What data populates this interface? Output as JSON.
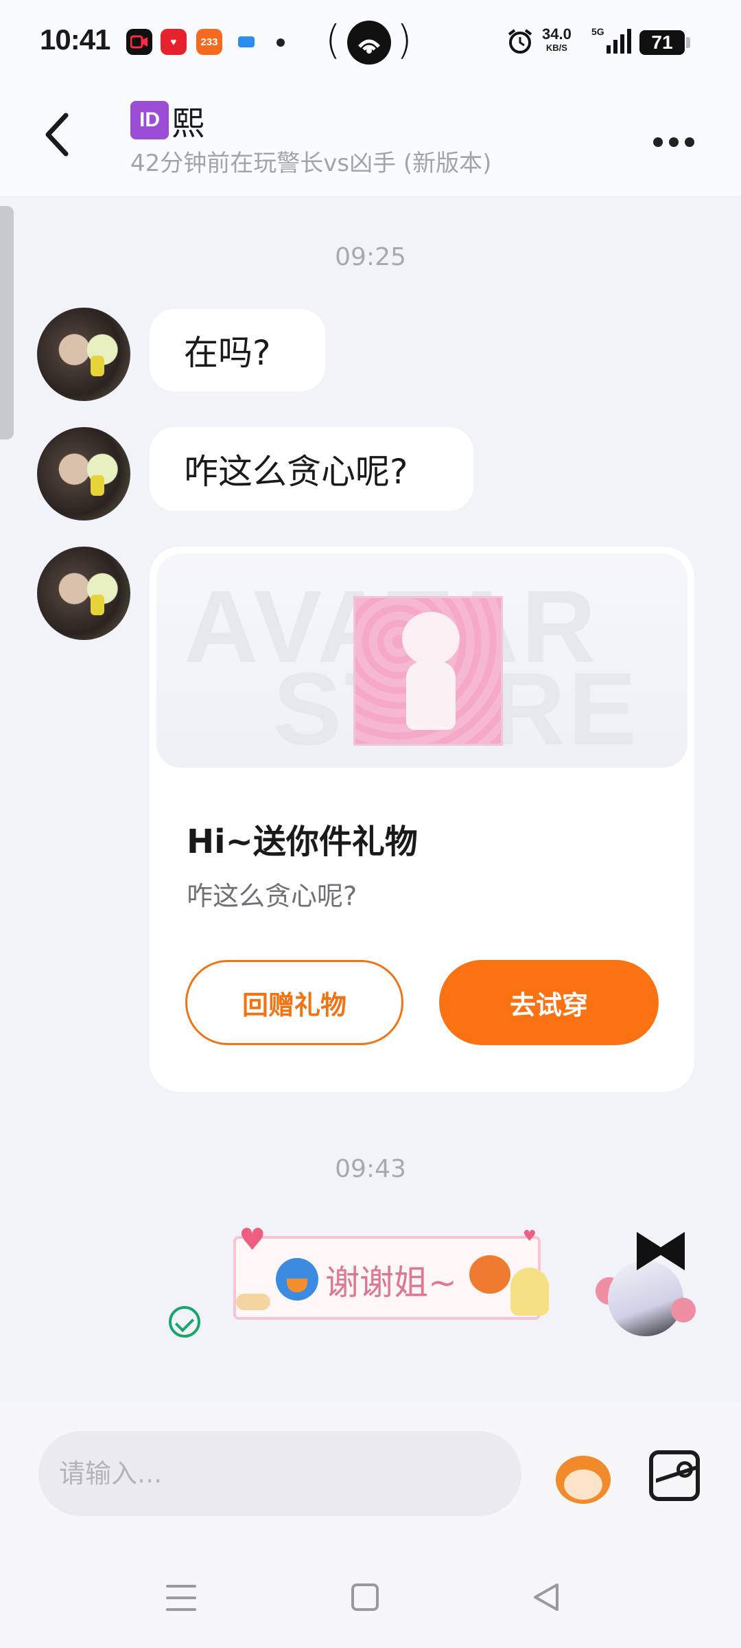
{
  "status_bar": {
    "time": "10:41",
    "app_badges": [
      "233"
    ],
    "speed_value": "34.0",
    "speed_unit": "KB/S",
    "network": "5G",
    "battery": "71"
  },
  "header": {
    "id_badge": "ID",
    "name": "熙",
    "subtitle": "42分钟前在玩警长vs凶手 (新版本)"
  },
  "messages": {
    "timestamp1": "09:25",
    "bubble1": "在吗?",
    "bubble2": "咋这么贪心呢?",
    "gift": {
      "watermark_line1": "AVATAR",
      "watermark_line2": "STORE",
      "title": "Hi~送你件礼物",
      "desc": "咋这么贪心呢?",
      "return_gift_label": "回赠礼物",
      "try_on_label": "去试穿"
    },
    "timestamp2": "09:43",
    "sticker_text": "谢谢姐~"
  },
  "input": {
    "placeholder": "请输入..."
  },
  "colors": {
    "accent": "#fb7212",
    "sent": "#1aa56b",
    "id_badge": "#9b4dd6"
  },
  "icons": [
    "back-arrow-icon",
    "more-icon",
    "emoji-icon",
    "image-icon",
    "sent-check-icon",
    "nav-menu-icon",
    "nav-home-icon",
    "nav-back-icon"
  ]
}
